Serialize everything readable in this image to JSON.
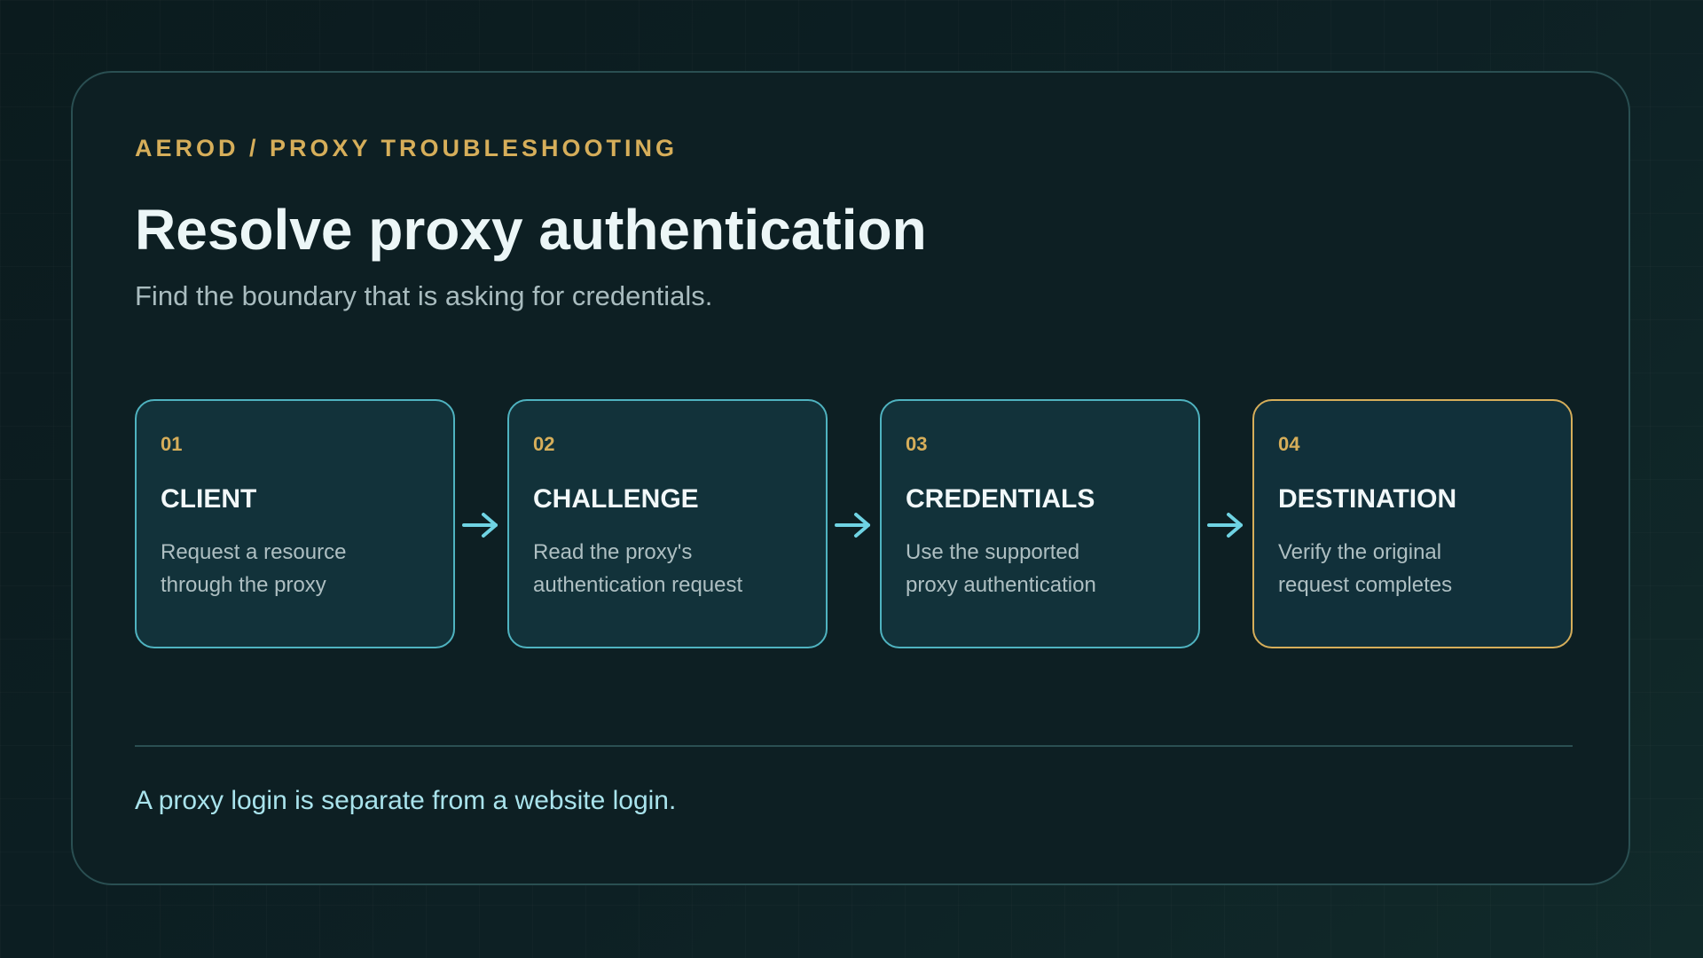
{
  "header": {
    "eyebrow": "AEROD / PROXY TROUBLESHOOTING",
    "title": "Resolve proxy authentication",
    "subtitle": "Find the boundary that is asking for credentials."
  },
  "steps": [
    {
      "number": "01",
      "title": "CLIENT",
      "desc_line1": "Request a resource",
      "desc_line2": "through the proxy"
    },
    {
      "number": "02",
      "title": "CHALLENGE",
      "desc_line1": "Read the proxy's",
      "desc_line2": "authentication request"
    },
    {
      "number": "03",
      "title": "CREDENTIALS",
      "desc_line1": "Use the supported",
      "desc_line2": "proxy authentication"
    },
    {
      "number": "04",
      "title": "DESTINATION",
      "desc_line1": "Verify the original",
      "desc_line2": "request completes"
    }
  ],
  "footer": {
    "note": "A proxy login is separate from a website login."
  },
  "colors": {
    "accent_gold": "#d6ae5a",
    "accent_cyan": "#4fb3c0",
    "arrow": "#6fd3e3"
  }
}
